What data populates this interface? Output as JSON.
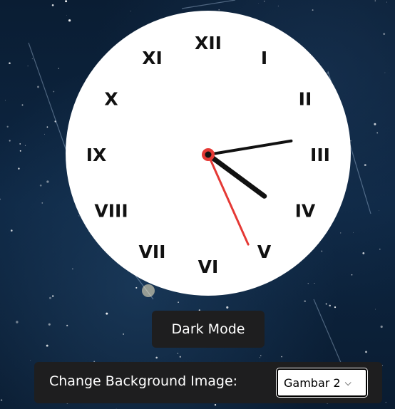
{
  "clock": {
    "numerals": [
      "XII",
      "I",
      "II",
      "III",
      "IV",
      "V",
      "VI",
      "VII",
      "VIII",
      "IX",
      "X",
      "XI"
    ],
    "time": {
      "hour": 4,
      "minute": 13,
      "second": 26
    },
    "colors": {
      "face": "#ffffff",
      "hands": "#111111",
      "second_hand": "#e53935",
      "numerals": "#111111"
    }
  },
  "controls": {
    "dark_mode_label": "Dark Mode",
    "background_label": "Change Background Image:",
    "background_select": {
      "value": "Gambar 2",
      "icon": "chevron-down-icon"
    }
  }
}
